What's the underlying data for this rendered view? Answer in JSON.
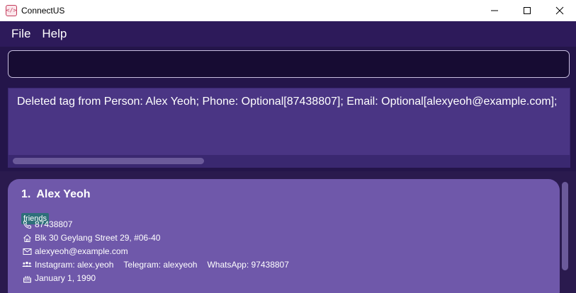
{
  "window": {
    "title": "ConnectUS",
    "icon": "code-icon",
    "icon_glyph": "</>"
  },
  "menu": {
    "items": [
      "File",
      "Help"
    ]
  },
  "command": {
    "value": "",
    "placeholder": ""
  },
  "result": {
    "text": "Deleted tag from Person: Alex Yeoh; Phone: Optional[87438807]; Email: Optional[alexyeoh@example.com];"
  },
  "persons": [
    {
      "index": "1.",
      "name": "Alex Yeoh",
      "tags": [
        "friends"
      ],
      "phone": "87438807",
      "address": "Blk 30 Geylang Street 29, #06-40",
      "email": "alexyeoh@example.com",
      "social": {
        "instagram": "Instagram: alex.yeoh",
        "telegram": "Telegram: alexyeoh",
        "whatsapp": "WhatsApp: 97438807"
      },
      "birthday": "January 1, 1990"
    }
  ],
  "colors": {
    "background": "#2a1a4e",
    "card": "#6f58aa",
    "result_box": "#4a3584",
    "command_box": "#170c33",
    "tag": "#2e6f7a"
  }
}
